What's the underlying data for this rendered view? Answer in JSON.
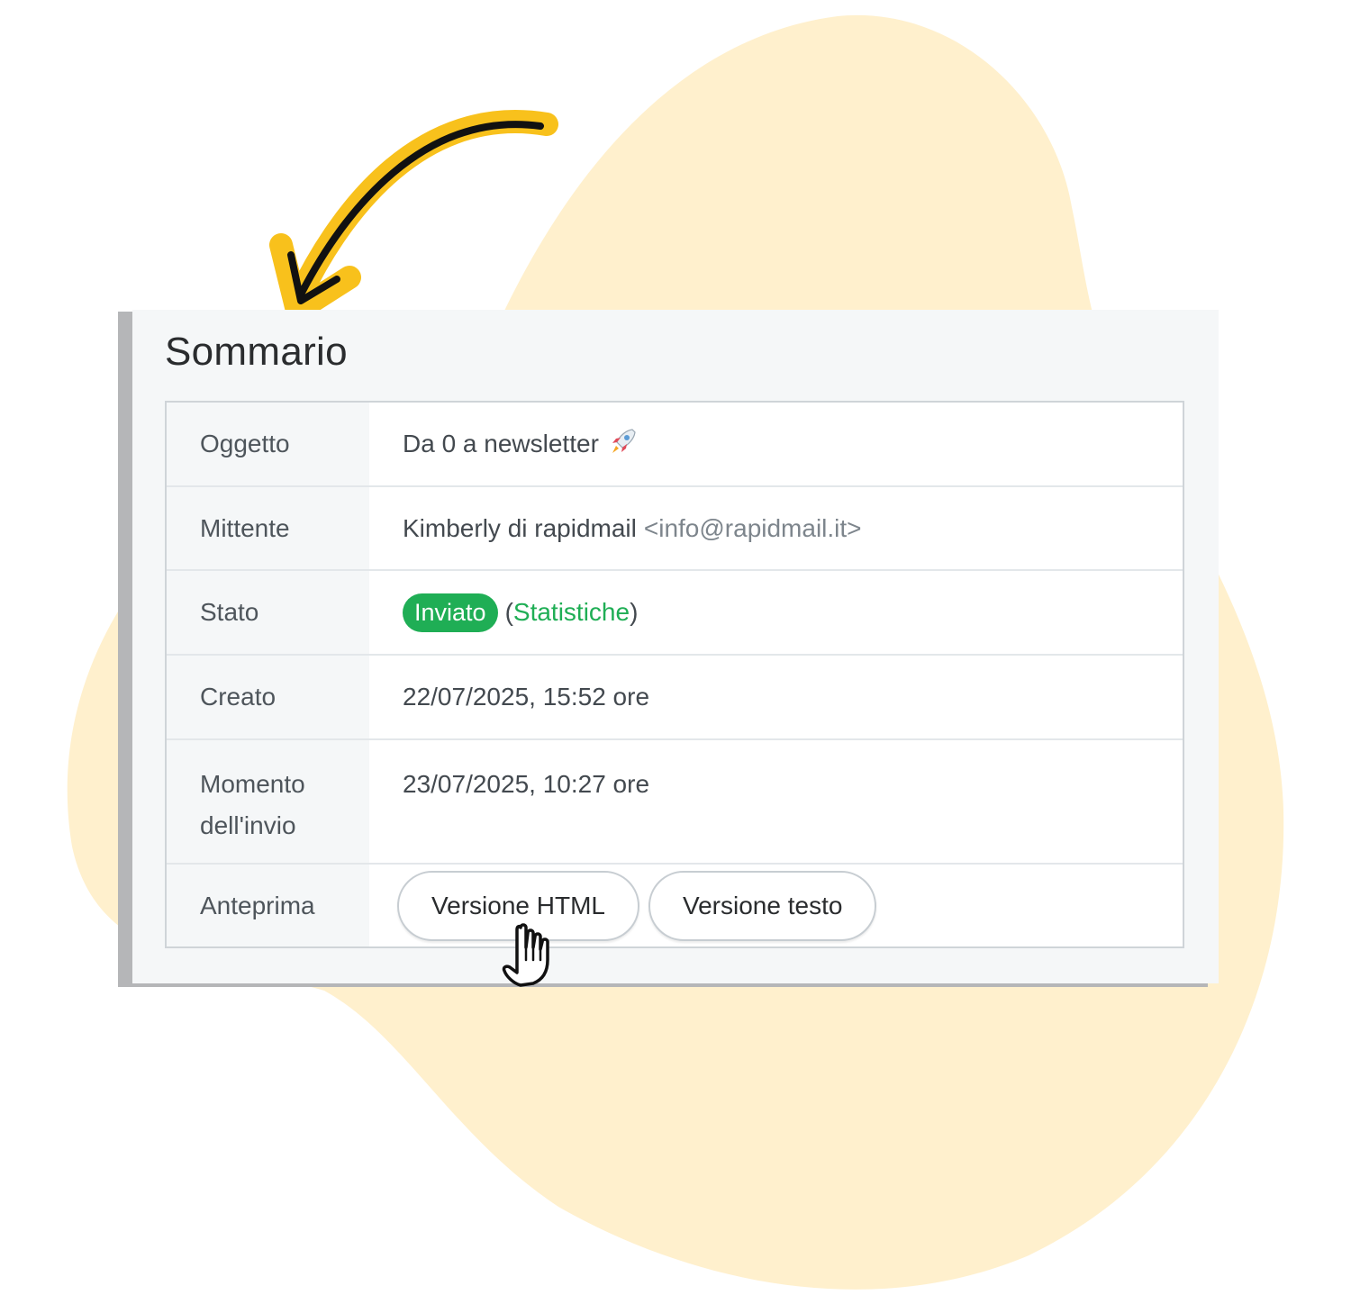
{
  "summary": {
    "title": "Sommario",
    "rows": [
      {
        "label": "Oggetto",
        "value": "Da 0 a newsletter"
      },
      {
        "label": "Mittente",
        "value": "Kimberly di rapidmail",
        "email": "<info@rapidmail.it>"
      },
      {
        "label": "Stato",
        "badge": "Inviato",
        "link_open": "(",
        "link": "Statistiche",
        "link_close": ")"
      },
      {
        "label": "Creato",
        "value": "22/07/2025, 15:52 ore"
      },
      {
        "label": "Momento dell'invio",
        "value": "23/07/2025, 10:27 ore"
      },
      {
        "label": "Anteprima",
        "buttons": [
          "Versione HTML",
          "Versione testo"
        ]
      }
    ]
  },
  "icons": {
    "subject": "rocket-icon",
    "cursor": "hand-pointer-icon",
    "callout": "curved-arrow-icon"
  },
  "colors": {
    "accent": "#1fae55",
    "blob": "#fff0cc",
    "arrow": "#f8c11c"
  }
}
